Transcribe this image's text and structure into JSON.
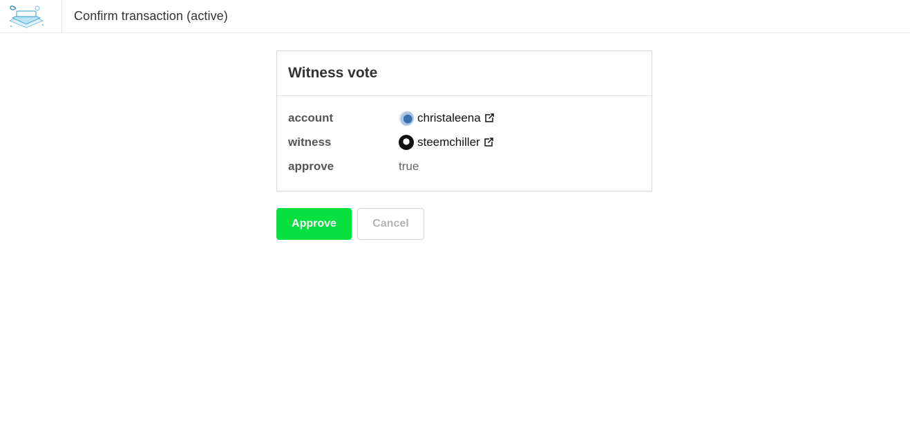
{
  "header": {
    "title": "Confirm transaction (active)",
    "logo_icon": "steemlogin-logo"
  },
  "operation": {
    "title": "Witness vote",
    "rows": [
      {
        "label": "account",
        "value": "christaleena",
        "avatar_icon": "user-avatar",
        "link_icon": "external-link-icon"
      },
      {
        "label": "witness",
        "value": "steemchiller",
        "avatar_icon": "user-avatar",
        "link_icon": "external-link-icon"
      },
      {
        "label": "approve",
        "value": "true"
      }
    ]
  },
  "actions": {
    "approve_label": "Approve",
    "cancel_label": "Cancel"
  },
  "colors": {
    "approve_bg": "#07e03e",
    "cancel_text": "#b3b3b3"
  }
}
